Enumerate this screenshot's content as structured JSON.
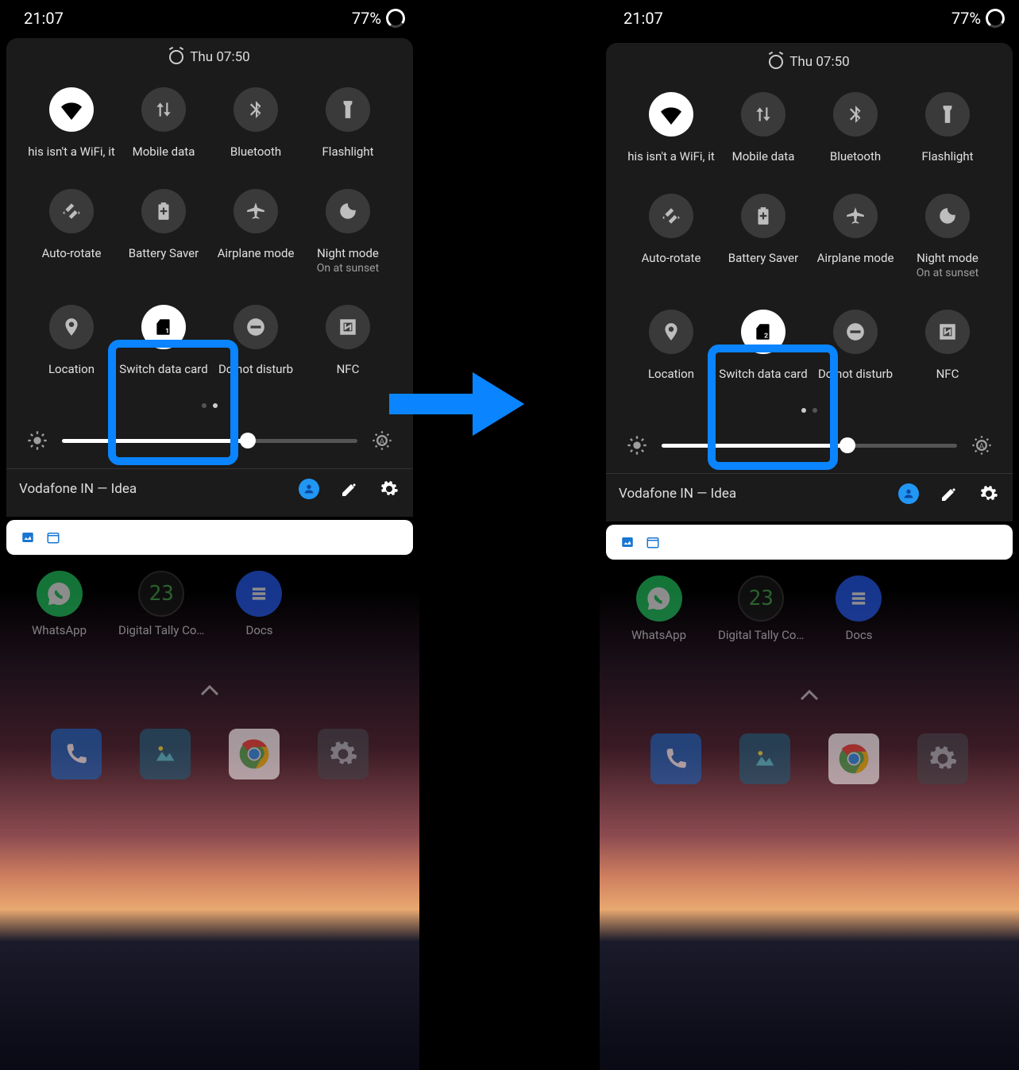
{
  "status": {
    "time": "21:07",
    "battery": "77%"
  },
  "header": {
    "datetime": "Thu 07:50"
  },
  "tiles": [
    {
      "id": "wifi",
      "label": "his isn't a WiFi, it",
      "sub": "",
      "active": true,
      "icon": "wifi"
    },
    {
      "id": "mobiledata",
      "label": "Mobile data",
      "sub": "",
      "active": false,
      "icon": "swap"
    },
    {
      "id": "bluetooth",
      "label": "Bluetooth",
      "sub": "",
      "active": false,
      "icon": "bluetooth"
    },
    {
      "id": "flashlight",
      "label": "Flashlight",
      "sub": "",
      "active": false,
      "icon": "flash"
    },
    {
      "id": "autorotate",
      "label": "Auto-rotate",
      "sub": "",
      "active": false,
      "icon": "rotate"
    },
    {
      "id": "battsaver",
      "label": "Battery Saver",
      "sub": "",
      "active": false,
      "icon": "battery"
    },
    {
      "id": "airplane",
      "label": "Airplane mode",
      "sub": "",
      "active": false,
      "icon": "airplane"
    },
    {
      "id": "nightmode",
      "label": "Night mode",
      "sub": "On at sunset",
      "active": false,
      "icon": "moon"
    },
    {
      "id": "location",
      "label": "Location",
      "sub": "",
      "active": false,
      "icon": "location"
    },
    {
      "id": "switchcard",
      "label": "Switch data card",
      "sub": "",
      "active": true,
      "icon": "sim",
      "highlight": true
    },
    {
      "id": "dnd",
      "label": "Do not disturb",
      "sub": "",
      "active": false,
      "icon": "dnd"
    },
    {
      "id": "nfc",
      "label": "NFC",
      "sub": "",
      "active": false,
      "icon": "nfc"
    }
  ],
  "switchcard_left_num": "1",
  "switchcard_right_num": "2",
  "brightness_pct": 63,
  "footer": {
    "carrier": "Vodafone IN — Idea"
  },
  "apps": [
    {
      "name": "WhatsApp",
      "label": "WhatsApp",
      "color": "#25d366"
    },
    {
      "name": "Digital Tally Co…",
      "label": "Digital Tally Co…",
      "color": "#1a1a1a"
    },
    {
      "name": "Docs",
      "label": "Docs",
      "color": "#2962ff"
    }
  ],
  "dock": [
    {
      "name": "phone",
      "color": "#1565c0"
    },
    {
      "name": "photos",
      "color": "#1b5e7a"
    },
    {
      "name": "chrome",
      "color": "#fff"
    },
    {
      "name": "settings",
      "color": "#404448"
    }
  ],
  "accent": "#0a84ff"
}
